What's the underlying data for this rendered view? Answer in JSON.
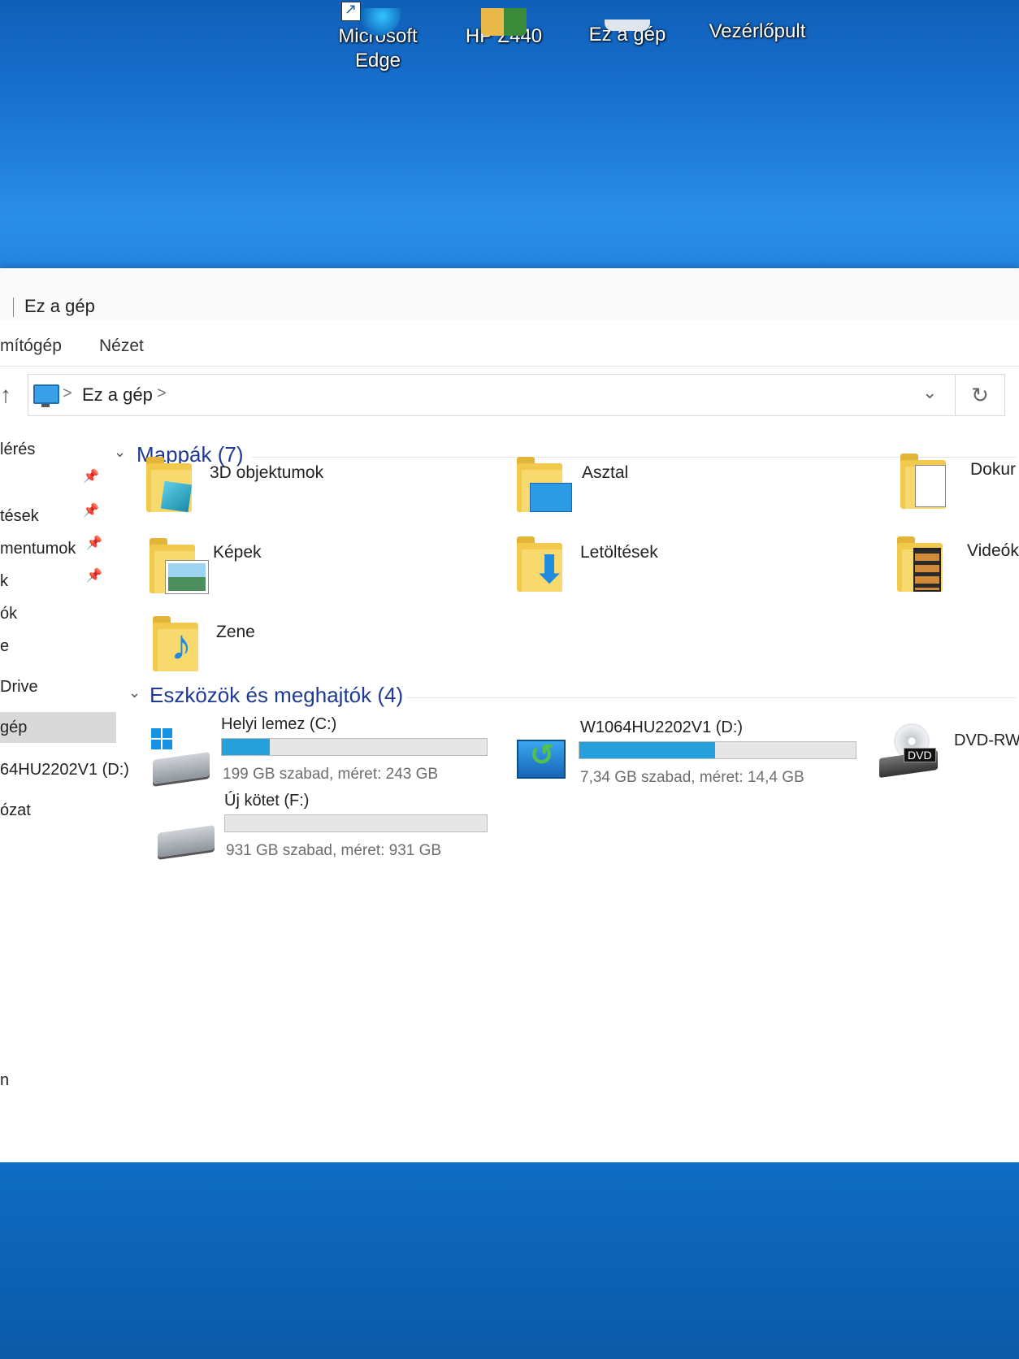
{
  "desktop": {
    "icons": [
      {
        "label_line1": "Microsoft",
        "label_line2": "Edge"
      },
      {
        "label_line1": "HP Z440"
      },
      {
        "label_line1": "Ez a gép"
      },
      {
        "label_line1": "Vezérlőpult"
      }
    ]
  },
  "window": {
    "title": "Ez a gép",
    "ribbon_tabs": [
      "mítógép",
      "Nézet"
    ],
    "address": {
      "location": "Ez a gép",
      "sep": ">"
    },
    "refresh_glyph": "↻",
    "dropdown_glyph": "⌄",
    "up_glyph": "↑"
  },
  "nav": {
    "items": [
      "lérés",
      "",
      "tések",
      "mentumok",
      "k",
      "ók",
      "e",
      "Drive",
      "gép",
      "64HU2202V1 (D:)",
      "ózat",
      "n"
    ],
    "pin_glyph": "📌"
  },
  "folders_section": {
    "title": "Mappák (7)",
    "items": [
      "3D objektumok",
      "Asztal",
      "Dokur",
      "Képek",
      "Letöltések",
      "Videók",
      "Zene"
    ]
  },
  "drives_section": {
    "title": "Eszközök és meghajtók (4)",
    "drives": [
      {
        "name": "Helyi lemez (C:)",
        "detail": "199 GB szabad, méret: 243 GB",
        "used_fraction": 0.18
      },
      {
        "name": "W1064HU2202V1 (D:)",
        "detail": "7,34 GB szabad, méret: 14,4 GB",
        "used_fraction": 0.49
      },
      {
        "name": "DVD-RW",
        "icon_text": "DVD"
      },
      {
        "name": "Új kötet (F:)",
        "detail": "931 GB szabad, méret: 931 GB",
        "used_fraction": 0.0
      }
    ]
  },
  "colors": {
    "accent": "#26a0da",
    "section_title": "#1f3a93",
    "folder": "#f0c94d"
  }
}
